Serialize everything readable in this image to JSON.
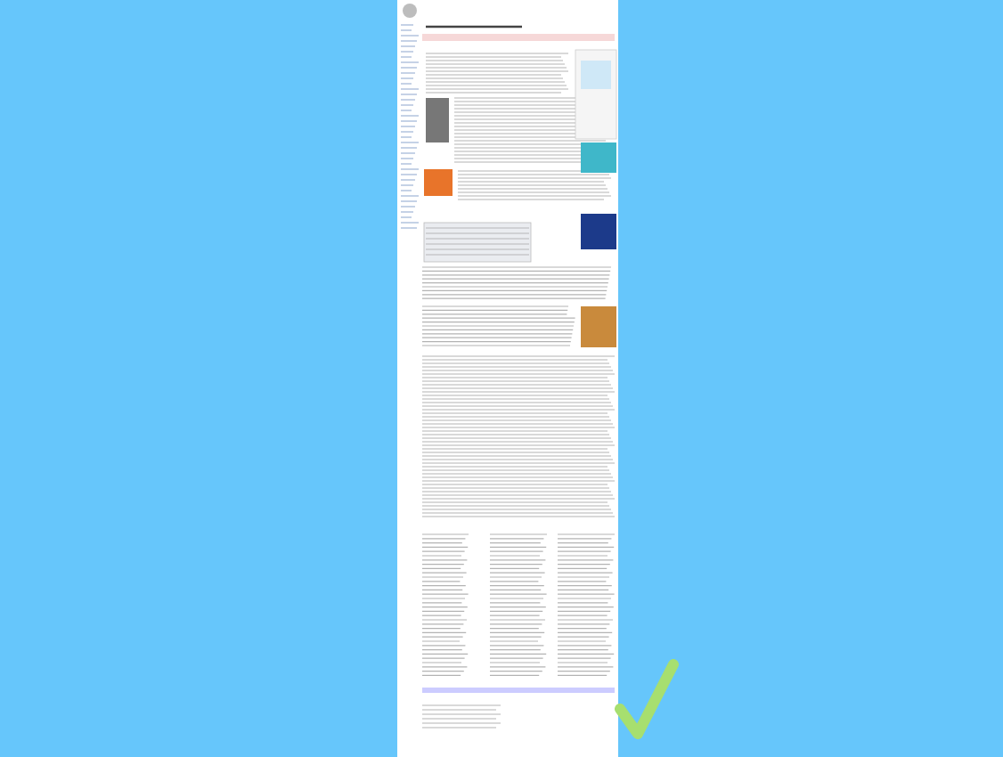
{
  "page_preview": {
    "kind": "article"
  },
  "checkmark": {
    "checked": true
  }
}
